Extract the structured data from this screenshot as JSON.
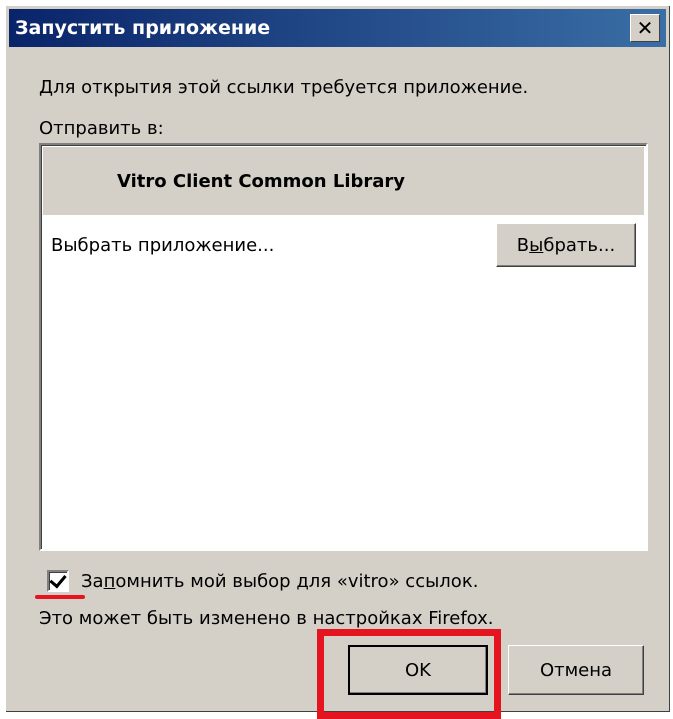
{
  "dialog": {
    "title": "Запустить приложение",
    "description": "Для открытия этой ссылки требуется приложение.",
    "send_to_label": "Отправить в:"
  },
  "app_list": {
    "items": [
      {
        "name": "Vitro Client Common Library",
        "selected": true
      }
    ],
    "choose_label": "Выбрать приложение...",
    "choose_button_prefix": "В",
    "choose_button_mnemonic": "ы",
    "choose_button_suffix": "брать..."
  },
  "remember": {
    "checked": true,
    "label_prefix": "За",
    "label_mnemonic": "п",
    "label_suffix": "омнить мой выбор для «vitro» ссылок."
  },
  "note": "Это может быть изменено в настройках Firefox.",
  "buttons": {
    "ok_label": "OK",
    "cancel_label": "Отмена"
  },
  "colors": {
    "annotation_red": "#e5141e",
    "titlebar_start": "#0a246a",
    "titlebar_end": "#3a6ea5",
    "face": "#d4d0c8"
  },
  "icons": {
    "close": "close-icon",
    "checkbox": "checkmark-icon"
  }
}
